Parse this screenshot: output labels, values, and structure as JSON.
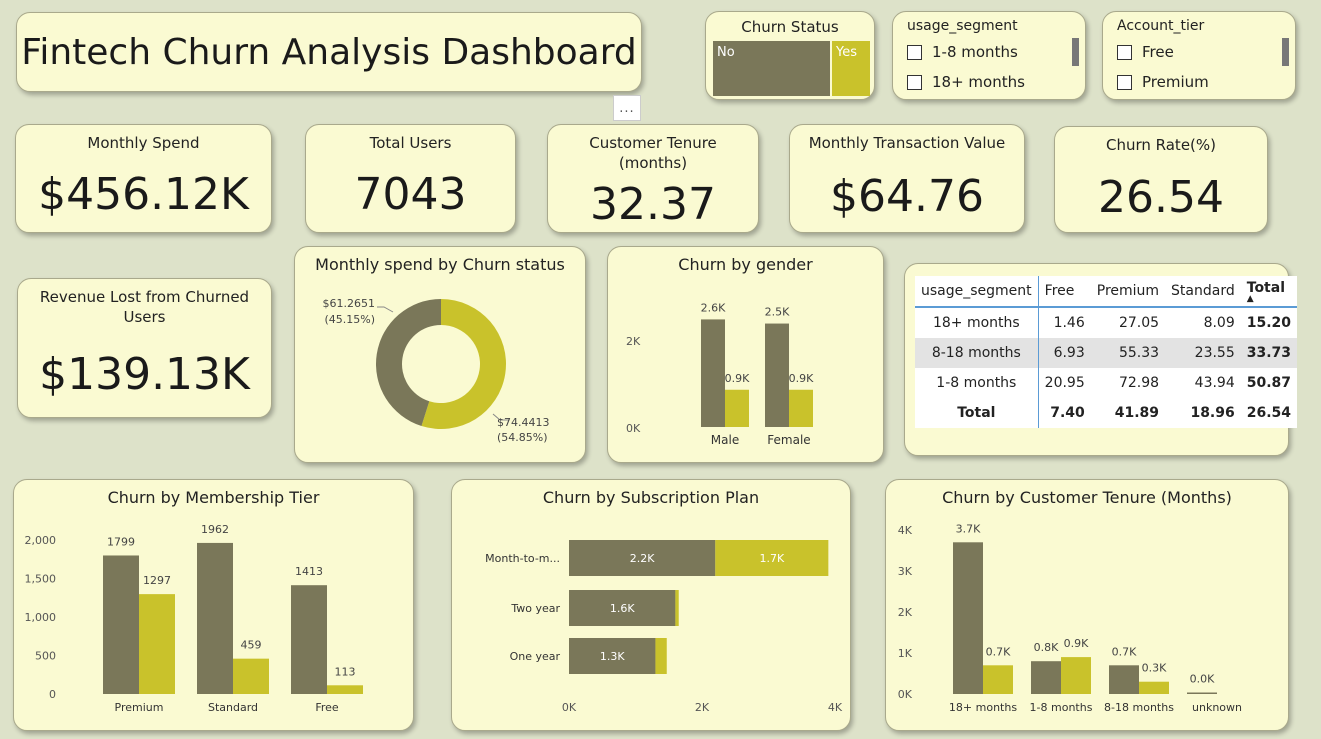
{
  "title": "Fintech Churn Analysis Dashboard",
  "more_options": "...",
  "churn_status_slicer": {
    "title": "Churn Status",
    "options": [
      "No",
      "Yes"
    ]
  },
  "usage_segment_slicer": {
    "title": "usage_segment",
    "options": [
      "1-8 months",
      "18+ months"
    ]
  },
  "account_tier_slicer": {
    "title": "Account_tier",
    "options": [
      "Free",
      "Premium"
    ]
  },
  "kpis": {
    "monthly_spend": {
      "label": "Monthly Spend",
      "value": "$456.12K"
    },
    "total_users": {
      "label": "Total Users",
      "value": "7043"
    },
    "tenure": {
      "label": "Customer Tenure (months)",
      "value": "32.37"
    },
    "transaction_value": {
      "label": "Monthly Transaction Value",
      "value": "$64.76"
    },
    "churn_rate": {
      "label": "Churn Rate(%)",
      "value": "26.54"
    },
    "revenue_lost": {
      "label": "Revenue Lost from Churned Users",
      "value": "$139.13K"
    }
  },
  "colors": {
    "no": "#7a7759",
    "yes": "#c9c22b",
    "card": "#fafad2",
    "background": "#dde2c9"
  },
  "chart_data": [
    {
      "id": "donut",
      "type": "pie",
      "title": "Monthly spend by Churn status",
      "categories": [
        "No",
        "Yes"
      ],
      "values": [
        74.4413,
        61.2651
      ],
      "percents": [
        54.85,
        45.15
      ],
      "labels": [
        {
          "value": "$74.4413",
          "pct": "(54.85%)"
        },
        {
          "value": "$61.2651",
          "pct": "(45.15%)"
        }
      ]
    },
    {
      "id": "gender",
      "type": "bar",
      "title": "Churn by gender",
      "categories": [
        "Male",
        "Female"
      ],
      "series": [
        {
          "values": [
            2.6,
            2.5
          ]
        },
        {
          "values": [
            0.9,
            0.9
          ]
        }
      ],
      "data_labels": [
        [
          "2.6K",
          "2.5K"
        ],
        [
          "0.9K",
          "0.9K"
        ]
      ],
      "yticks": [
        "0K",
        "2K"
      ],
      "ylim": [
        0,
        2.9
      ]
    },
    {
      "id": "tier",
      "type": "bar",
      "title": "Churn by Membership Tier",
      "categories": [
        "Premium",
        "Standard",
        "Free"
      ],
      "series": [
        {
          "values": [
            1799,
            1962,
            1413
          ]
        },
        {
          "values": [
            1297,
            459,
            113
          ]
        }
      ],
      "data_labels": [
        [
          "1799",
          "1962",
          "1413"
        ],
        [
          "1297",
          "459",
          "113"
        ]
      ],
      "yticks": [
        "0",
        "500",
        "1,000",
        "1,500",
        "2,000"
      ],
      "ylim": [
        0,
        2000
      ]
    },
    {
      "id": "plan",
      "type": "bar",
      "orientation": "horizontal",
      "stacked": true,
      "title": "Churn by Subscription Plan",
      "categories": [
        "Month-to-m...",
        "Two year",
        "One year"
      ],
      "series": [
        {
          "values": [
            2.2,
            1.6,
            1.3
          ]
        },
        {
          "values": [
            1.7,
            0.05,
            0.17
          ]
        }
      ],
      "data_labels": [
        [
          "2.2K",
          "1.6K",
          "1.3K"
        ],
        [
          "1.7K",
          "",
          ""
        ]
      ],
      "xticks": [
        "0K",
        "2K",
        "4K"
      ],
      "xlim": [
        0,
        4
      ]
    },
    {
      "id": "tenure",
      "type": "bar",
      "title": "Churn by Customer Tenure (Months)",
      "categories": [
        "18+ months",
        "1-8 months",
        "8-18 months",
        "unknown"
      ],
      "series": [
        {
          "values": [
            3.7,
            0.8,
            0.7,
            0.0
          ]
        },
        {
          "values": [
            0.7,
            0.9,
            0.3,
            0.0
          ]
        }
      ],
      "data_labels": [
        [
          "3.7K",
          "0.8K",
          "0.7K",
          "0.0K"
        ],
        [
          "0.7K",
          "0.9K",
          "0.3K",
          ""
        ]
      ],
      "yticks": [
        "0K",
        "1K",
        "2K",
        "3K",
        "4K"
      ],
      "ylim": [
        0,
        4
      ]
    },
    {
      "id": "matrix",
      "type": "table",
      "columns": [
        "usage_segment",
        "Free",
        "Premium",
        "Standard",
        "Total"
      ],
      "rows": [
        [
          "18+ months",
          "1.46",
          "27.05",
          "8.09",
          "15.20"
        ],
        [
          "8-18 months",
          "6.93",
          "55.33",
          "23.55",
          "33.73"
        ],
        [
          "1-8 months",
          "20.95",
          "72.98",
          "43.94",
          "50.87"
        ]
      ],
      "total_row": [
        "Total",
        "7.40",
        "41.89",
        "18.96",
        "26.54"
      ]
    }
  ]
}
